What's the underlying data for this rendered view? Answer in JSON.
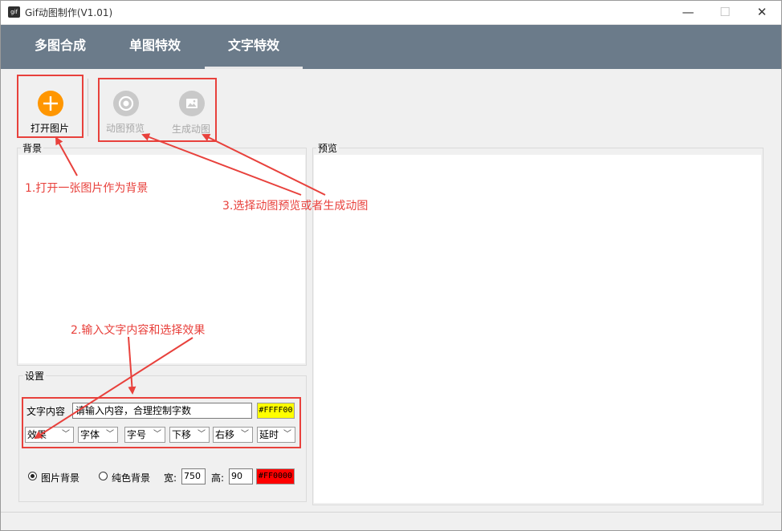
{
  "window": {
    "title": "Gif动图制作(V1.01)",
    "icon_text": "gif",
    "minimize_glyph": "—",
    "maximize_glyph": "☐",
    "close_glyph": "✕"
  },
  "tabs": [
    {
      "label": "多图合成"
    },
    {
      "label": "单图特效"
    },
    {
      "label": "文字特效",
      "selected": true
    }
  ],
  "toolbar": {
    "open_label": "打开图片",
    "preview_label": "动图预览",
    "generate_label": "生成动图"
  },
  "panels": {
    "background_label": "背景",
    "preview_label": "预览",
    "settings_label": "设置"
  },
  "settings": {
    "text_label": "文字内容",
    "text_value": "请输入内容，合理控制字数",
    "text_color": "#FFFF00",
    "combos": {
      "effect": "效果",
      "font": "字体",
      "size": "字号",
      "down": "下移",
      "right": "右移",
      "delay": "延时"
    },
    "radio_image_bg": "图片背景",
    "radio_solid_bg": "纯色背景",
    "selected_background": "图片背景",
    "width_label": "宽:",
    "width_value": "750",
    "height_label": "高:",
    "height_value": "90",
    "bg_color": "#FF0000"
  },
  "annotations": {
    "step1": "1.打开一张图片作为背景",
    "step2": "2.输入文字内容和选择效果",
    "step3": "3.选择动图预览或者生成动图"
  },
  "colors": {
    "tab_bar": "#6b7b8a",
    "accent_orange": "#ff9600",
    "annotation_red": "#e8413c"
  },
  "icons": {
    "open": "plus-icon",
    "preview": "eye-icon",
    "generate": "image-icon"
  }
}
